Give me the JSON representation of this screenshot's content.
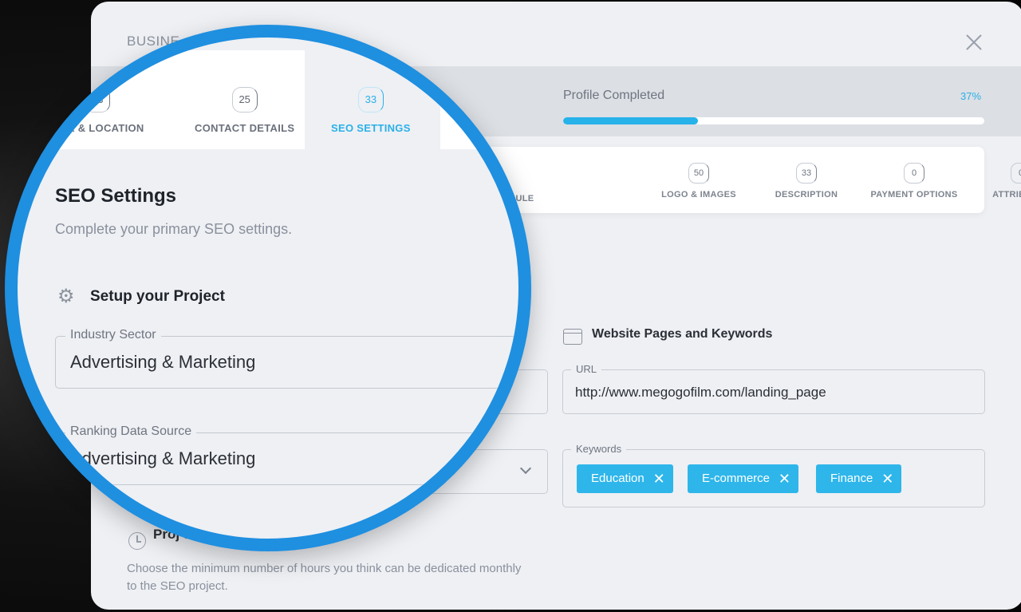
{
  "modal": {
    "title": "BUSINE",
    "progress": {
      "label": "Profile Completed",
      "value_text": "37%",
      "fraction": 0.32
    },
    "subtabs": [
      {
        "badge": "",
        "label": "EDULE"
      },
      {
        "badge": "50",
        "label": "LOGO & IMAGES"
      },
      {
        "badge": "33",
        "label": "DESCRIPTION"
      },
      {
        "badge": "0",
        "label": "PAYMENT OPTIONS"
      },
      {
        "badge": "0",
        "label": "ATTRIBUTES"
      }
    ],
    "pages_section": {
      "heading": "Website Pages and Keywords",
      "url_label": "URL",
      "url_value": "http://www.megogofilm.com/landing_page",
      "keywords_label": "Keywords",
      "keywords": [
        "Education",
        "E-commerce",
        "Finance"
      ]
    },
    "hours_section": {
      "heading": "Proj        urs",
      "description": "Choose the minimum number of hours you think can be dedicated monthly to the SEO project."
    }
  },
  "magnifier": {
    "tabs": [
      {
        "badge": "33",
        "label": "AME & LOCATION"
      },
      {
        "badge": "25",
        "label": "CONTACT DETAILS"
      },
      {
        "badge": "33",
        "label": "SEO SETTINGS",
        "active": true
      }
    ],
    "title": "SEO Settings",
    "subtitle": "Complete your primary SEO settings.",
    "setup_heading": "Setup your Project",
    "industry": {
      "label": "Industry Sector",
      "value": "Advertising & Marketing"
    },
    "ranking": {
      "label": "Ranking Data Source",
      "value": "Advertising & Marketing"
    }
  },
  "colors": {
    "accent": "#2ab0e8",
    "ring": "#1f8fe0",
    "chip": "#2eb6ea"
  }
}
